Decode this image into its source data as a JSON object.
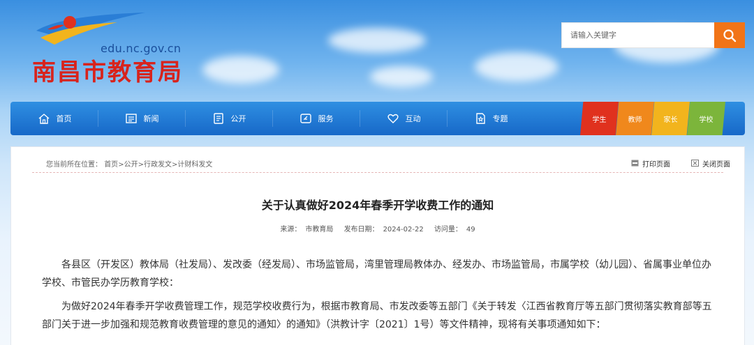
{
  "header": {
    "logo_domain": "edu.nc.gov.cn",
    "logo_name": "南昌市教育局",
    "search_placeholder": "请输入关键字"
  },
  "nav": {
    "items": [
      {
        "label": "首页",
        "icon": "home-icon"
      },
      {
        "label": "新闻",
        "icon": "newspaper-icon"
      },
      {
        "label": "公开",
        "icon": "document-icon"
      },
      {
        "label": "服务",
        "icon": "service-icon"
      },
      {
        "label": "互动",
        "icon": "heart-icon"
      },
      {
        "label": "专题",
        "icon": "star-document-icon"
      }
    ],
    "roles": [
      "学生",
      "教师",
      "家长",
      "学校"
    ]
  },
  "breadcrumb": {
    "prefix": "您当前所在位置：",
    "items": [
      "首页",
      "公开",
      "行政发文",
      "计财科发文"
    ]
  },
  "tools": {
    "print": "打印页面",
    "close": "关闭页面"
  },
  "article": {
    "title": "关于认真做好2024年春季开学收费工作的通知",
    "source_label": "来源：",
    "source": "市教育局",
    "date_label": "发布日期：",
    "date": "2024-02-22",
    "views_label": "访问量：",
    "views": "49",
    "paragraphs": [
      "各县区（开发区）教体局（社发局）、发改委（经发局）、市场监管局，湾里管理局教体办、经发办、市场监管局，市属学校（幼儿园）、省属事业单位办学校、市管民办学历教育学校：",
      "为做好2024年春季开学收费管理工作，规范学校收费行为，根据市教育局、市发改委等五部门《关于转发〈江西省教育厅等五部门贯彻落实教育部等五部门关于进一步加强和规范教育收费管理的意见的通知〉的通知》（洪教计字〔2021〕1号）等文件精神，现将有关事项通知如下："
    ]
  },
  "colors": {
    "nav_blue": "#1f7ad6",
    "search_orange": "#f17417",
    "logo_red": "#d8231c",
    "student": "#e0311e",
    "teacher": "#f0881c",
    "parent": "#f2b41d",
    "school": "#7cb53b"
  }
}
